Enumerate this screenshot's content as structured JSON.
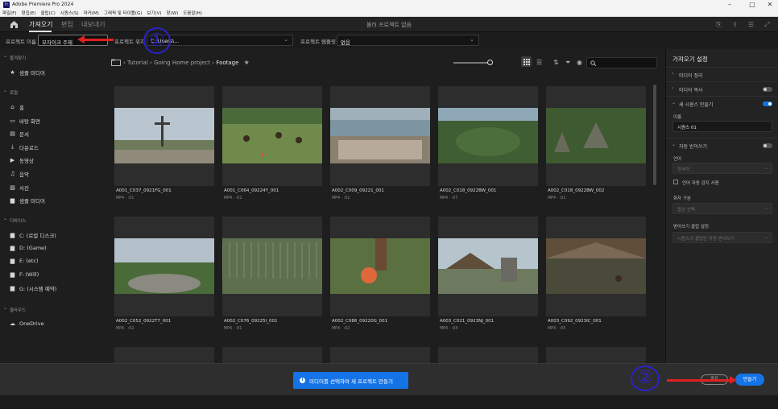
{
  "window": {
    "title": "Adobe Premiere Pro 2024",
    "app_icon": "Pr"
  },
  "menu": [
    "파일(F)",
    "편집(E)",
    "클립(C)",
    "시퀀스(S)",
    "마커(M)",
    "그래픽 및 타이틀(G)",
    "보기(V)",
    "창(W)",
    "도움말(H)"
  ],
  "workspace": {
    "tabs": [
      "가져오기",
      "편집",
      "내보내기"
    ],
    "center_title": "불러 프로젝트 없음"
  },
  "project_row": {
    "name_label": "프로젝트 이름",
    "name_value": "모자이크 주제",
    "location_label": "프로젝트 위치",
    "location_value": "C:\\Users\\...",
    "template_label": "프로젝트 템플릿",
    "template_value": "없음"
  },
  "annotations": {
    "circle1": "①",
    "circle2": "②"
  },
  "sidebar": {
    "sections": [
      {
        "header": "즐겨찾기",
        "items": [
          {
            "icon": "star-icon",
            "glyph": "★",
            "label": "샘플 미디어"
          }
        ]
      },
      {
        "header": "로컬",
        "items": [
          {
            "icon": "home-icon",
            "glyph": "⌂",
            "label": "홈"
          },
          {
            "icon": "desktop-icon",
            "glyph": "▭",
            "label": "바탕 화면"
          },
          {
            "icon": "document-icon",
            "glyph": "▤",
            "label": "문서"
          },
          {
            "icon": "download-icon",
            "glyph": "⤓",
            "label": "다운로드"
          },
          {
            "icon": "video-icon",
            "glyph": "▶",
            "label": "동영상"
          },
          {
            "icon": "music-icon",
            "glyph": "♫",
            "label": "음악"
          },
          {
            "icon": "image-icon",
            "glyph": "▨",
            "label": "사진"
          },
          {
            "icon": "folder-icon",
            "glyph": "▆",
            "label": "샘플 미디어"
          }
        ]
      },
      {
        "header": "디바이스",
        "items": [
          {
            "icon": "drive-icon",
            "glyph": "▆",
            "label": "C: (로컬 디스크)"
          },
          {
            "icon": "drive-icon",
            "glyph": "▆",
            "label": "D: (Game)"
          },
          {
            "icon": "drive-icon",
            "glyph": "▆",
            "label": "E: (etc)"
          },
          {
            "icon": "drive-icon",
            "glyph": "▆",
            "label": "F: (Will)"
          },
          {
            "icon": "drive-icon",
            "glyph": "▆",
            "label": "G: (시스템 예약)"
          }
        ]
      },
      {
        "header": "클라우드",
        "items": [
          {
            "icon": "cloud-icon",
            "glyph": "☁",
            "label": "OneDrive"
          }
        ]
      }
    ]
  },
  "breadcrumb": {
    "segments": [
      "Tutorial",
      "Going Home project"
    ],
    "current": "Footage",
    "separator": "›"
  },
  "clips": [
    {
      "name": "A001_C037_0921FG_001",
      "meta": "MP4 · :01"
    },
    {
      "name": "A001_C064_09224Y_001",
      "meta": "MP4 · :02"
    },
    {
      "name": "A002_C009_09221_001",
      "meta": "MP4 · :02"
    },
    {
      "name": "A002_C018_0922BW_001",
      "meta": "MP4 · :07"
    },
    {
      "name": "A002_C018_0922BW_002",
      "meta": "MP4 · :01"
    },
    {
      "name": "A002_C052_0922T7_001",
      "meta": "MP4 · :02"
    },
    {
      "name": "A002_C076_09225I_001",
      "meta": "MP4 · :01"
    },
    {
      "name": "A002_C086_09220G_001",
      "meta": "MP4 · :02"
    },
    {
      "name": "A003_C021_0923NJ_001",
      "meta": "MP4 · :04"
    },
    {
      "name": "A003_C092_0923IC_001",
      "meta": "MP4 · :05"
    }
  ],
  "right_panel": {
    "title": "가져오기 설정",
    "rows": [
      {
        "label": "미디어 정리",
        "toggle": null
      },
      {
        "label": "미디어 복사",
        "toggle": false
      },
      {
        "label": "새 시퀀스 만들기",
        "toggle": true
      },
      {
        "label": "자동 받아쓰기",
        "toggle": false
      }
    ],
    "name_label": "이름",
    "name_value": "시퀀스 01",
    "language_label": "언어",
    "language_value": "한국어",
    "auto_detect_label": "언어 자동 감지 사용",
    "speaker_label": "화자 구분",
    "speaker_value": "옵션 선택",
    "transcribe_label": "받아쓰기 클립 설정",
    "transcribe_value": "시퀀스의 클립만 자동 받아쓰기"
  },
  "bottom": {
    "info_button": "미디어를 선택하여 새 프로젝트 만들기",
    "cancel": "종료",
    "create": "만들기"
  },
  "colors": {
    "accent": "#1473e6",
    "annotation_red": "#e02020",
    "annotation_blue": "#2a22c8"
  }
}
